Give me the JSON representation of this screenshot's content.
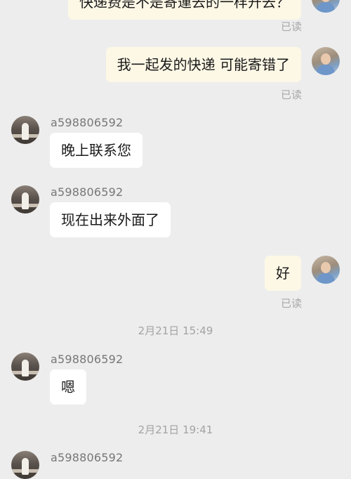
{
  "messages": [
    {
      "type": "self",
      "text": "快递费是不是寄運去的一样开去？"
    },
    {
      "type": "read_receipt",
      "text": "已读"
    },
    {
      "type": "self",
      "text": "我一起发的快递 可能寄错了"
    },
    {
      "type": "read_receipt",
      "text": "已读"
    },
    {
      "type": "other",
      "sender": "a598806592",
      "text": "晚上联系您"
    },
    {
      "type": "other",
      "sender": "a598806592",
      "text": "现在出来外面了"
    },
    {
      "type": "self",
      "text": "好"
    },
    {
      "type": "read_receipt",
      "text": "已读"
    },
    {
      "type": "timestamp",
      "text": "2月21日 15:49"
    },
    {
      "type": "other",
      "sender": "a598806592",
      "text": "嗯"
    },
    {
      "type": "timestamp",
      "text": "2月21日 19:41"
    },
    {
      "type": "other",
      "sender": "a598806592",
      "text": ""
    }
  ]
}
